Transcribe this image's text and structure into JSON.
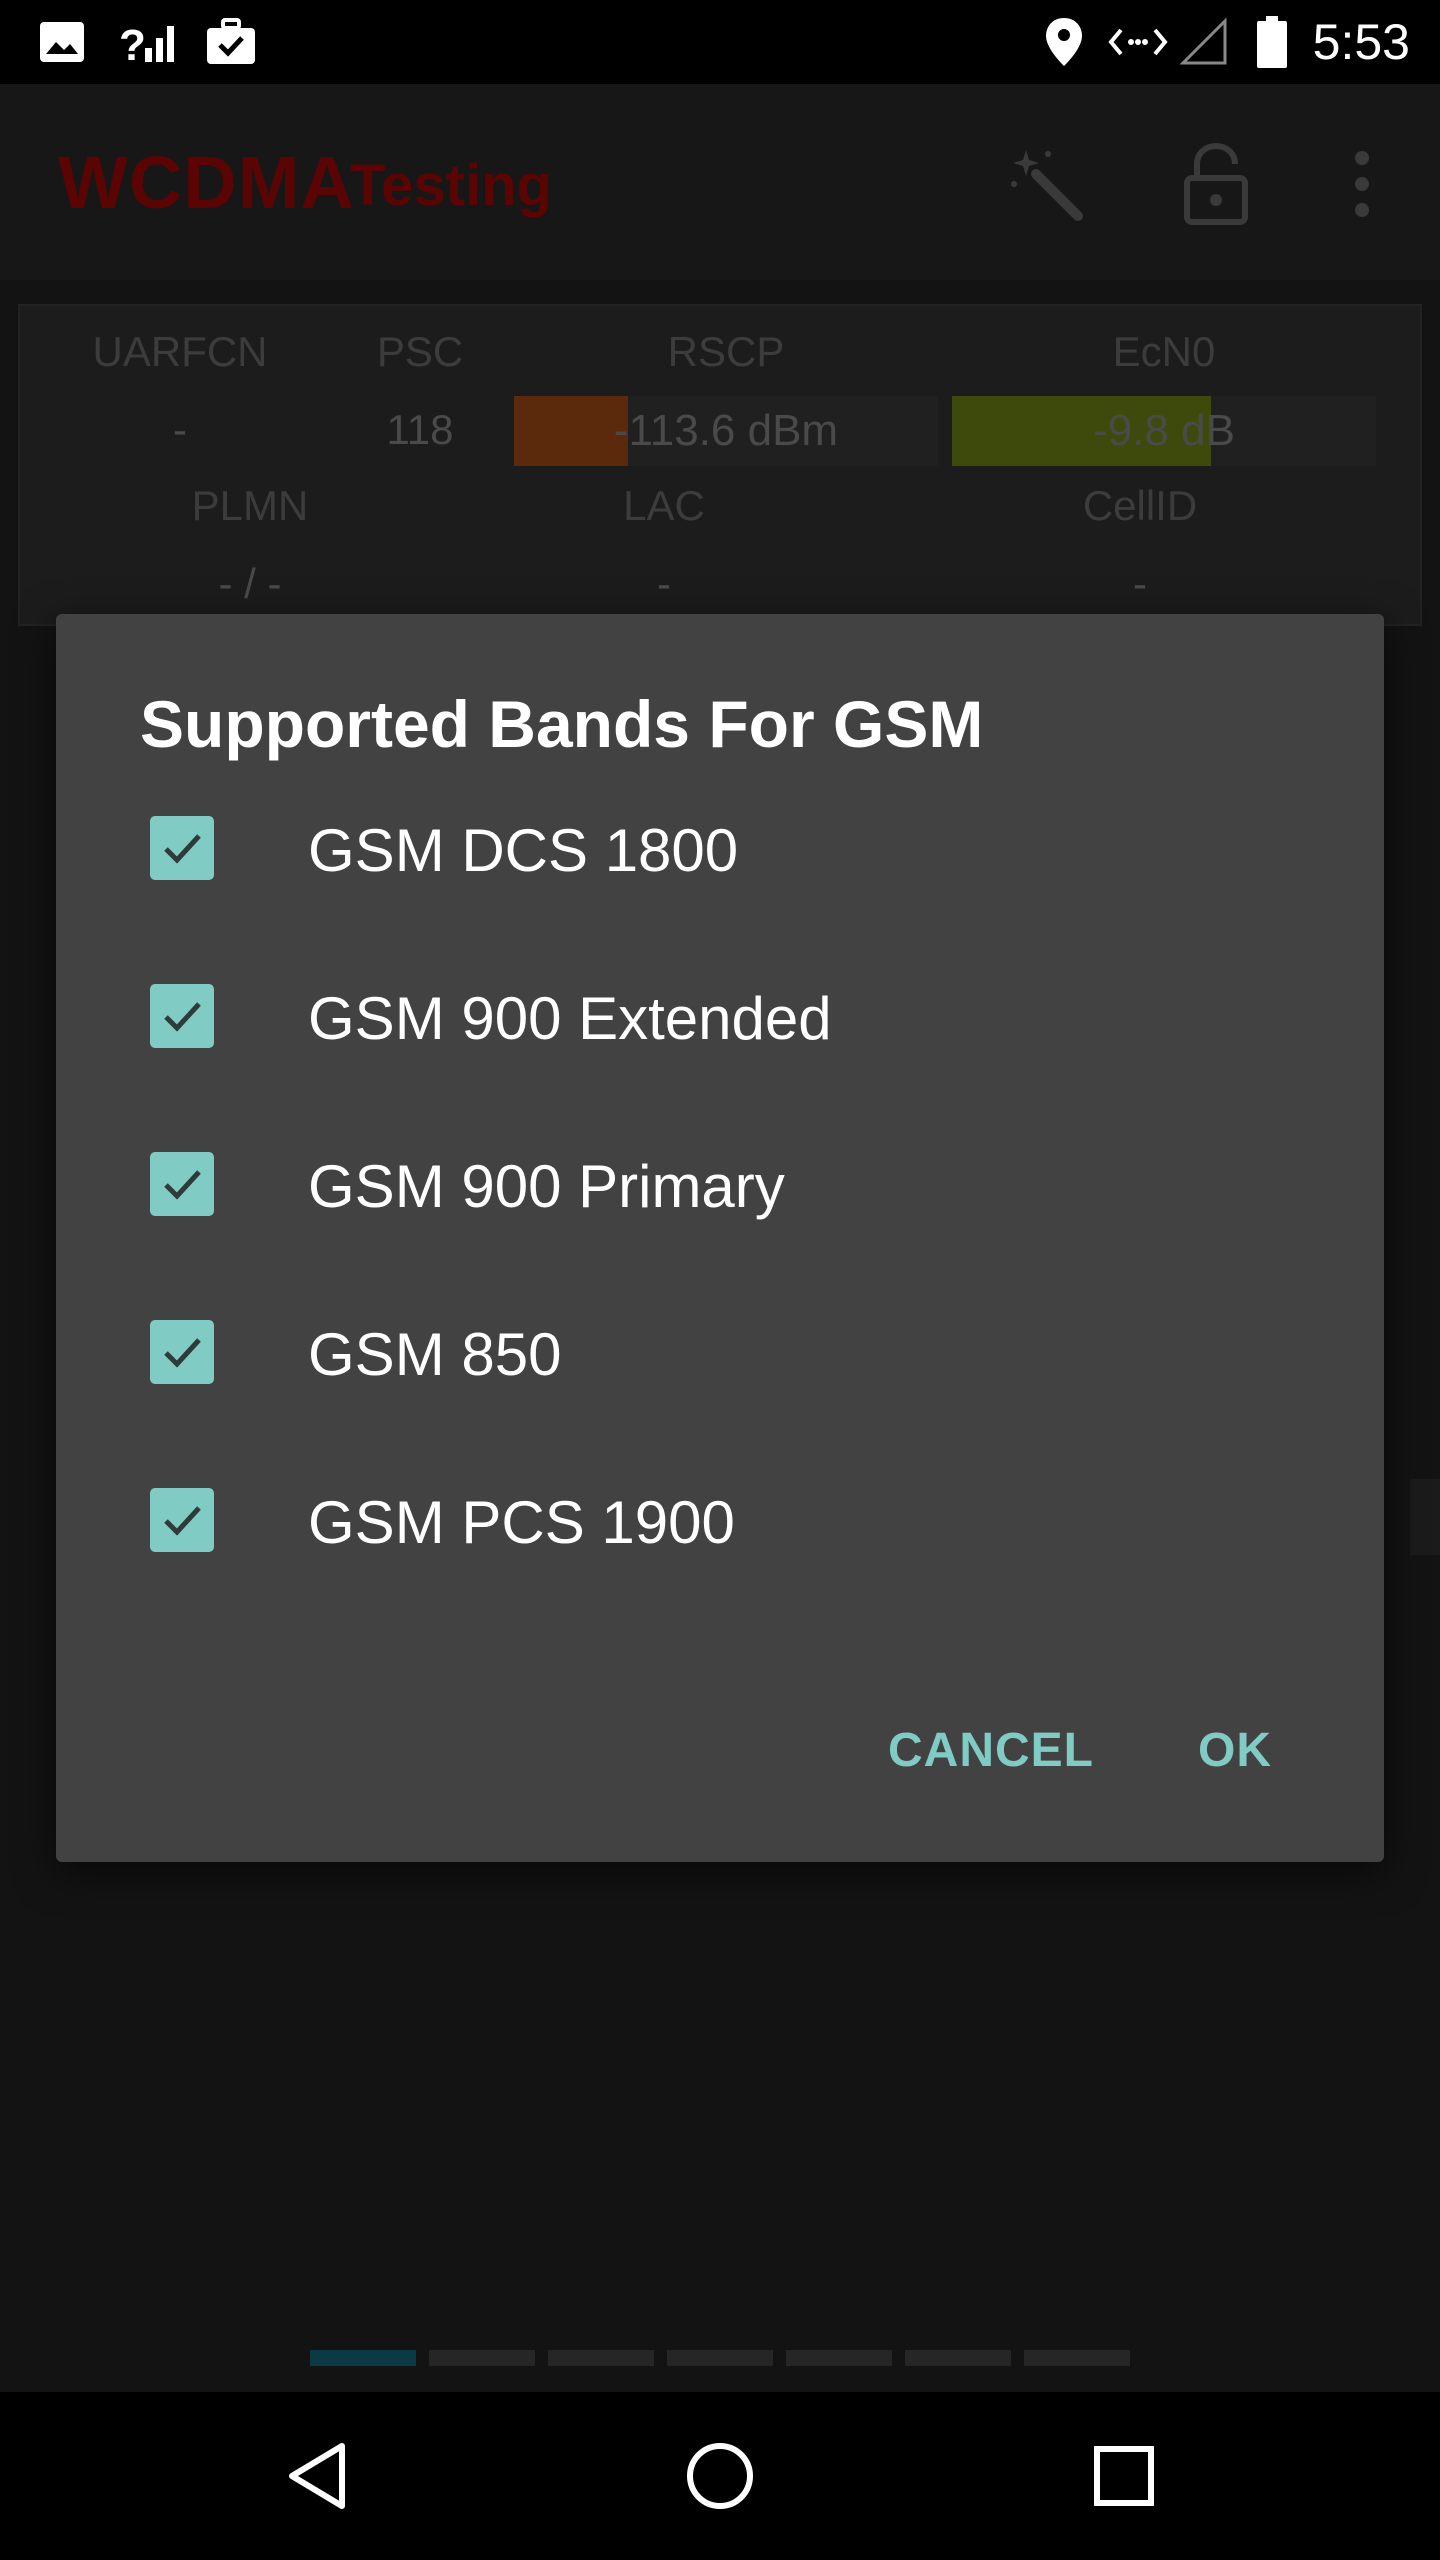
{
  "status_bar": {
    "time": "5:53",
    "icons": [
      "image-icon",
      "signal-unknown-icon",
      "briefcase-check-icon",
      "location-pin-icon",
      "data-arrows-icon",
      "signal-empty-icon",
      "battery-icon"
    ]
  },
  "app": {
    "title": "WCDMA",
    "subtitle": "Testing",
    "toolbar_icons": [
      "magic-wand-icon",
      "lock-open-icon",
      "more-vert-icon"
    ],
    "colors": {
      "title": "#5a0404",
      "rscp_bar": "#5b2a0c",
      "ecn0_bar": "#3d4a0b",
      "pager_active": "#0b3a44"
    }
  },
  "cell_info": {
    "uarfcn": {
      "label": "UARFCN",
      "value": "-"
    },
    "psc": {
      "label": "PSC",
      "value": "118"
    },
    "rscp": {
      "label": "RSCP",
      "value": "-113.6 dBm",
      "level": 0.27
    },
    "ecn0": {
      "label": "EcN0",
      "value": "-9.8 dB",
      "level": 0.61
    },
    "plmn": {
      "label": "PLMN",
      "value": "- / -"
    },
    "lac": {
      "label": "LAC",
      "value": "-"
    },
    "cellid": {
      "label": "CellID",
      "value": "-"
    }
  },
  "pager": {
    "count": 7,
    "active_index": 0
  },
  "dialog": {
    "title": "Supported Bands For GSM",
    "options": [
      {
        "label": "GSM DCS 1800",
        "checked": true
      },
      {
        "label": "GSM 900 Extended",
        "checked": true
      },
      {
        "label": "GSM 900 Primary",
        "checked": true
      },
      {
        "label": "GSM 850",
        "checked": true
      },
      {
        "label": "GSM PCS 1900",
        "checked": true
      }
    ],
    "cancel_label": "CANCEL",
    "ok_label": "OK",
    "accent_color": "#80cbc4"
  },
  "nav_bar": {
    "icons": [
      "back-icon",
      "home-icon",
      "recents-icon"
    ]
  }
}
